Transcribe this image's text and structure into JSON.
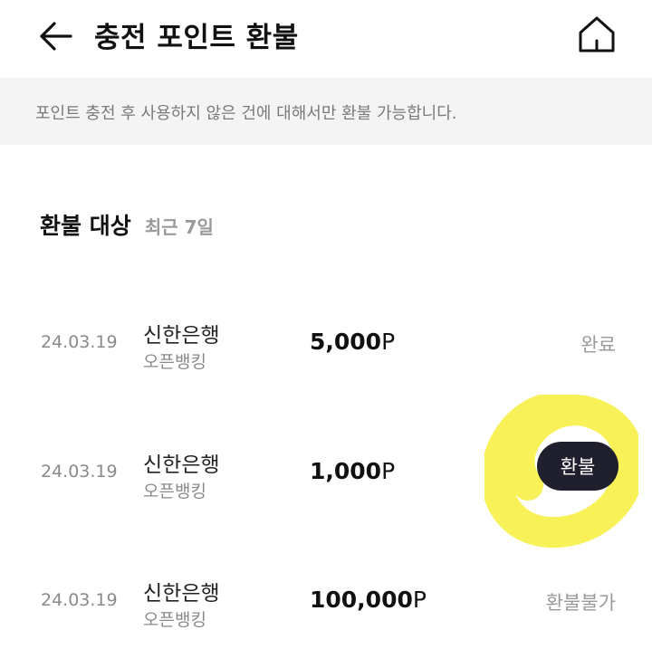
{
  "header": {
    "title": "충전 포인트 환불",
    "back_icon": "arrow-left-icon",
    "home_icon": "home-icon"
  },
  "notice": {
    "text": "포인트 충전 후 사용하지 않은 건에 대해서만 환불 가능합니다."
  },
  "section": {
    "title": "환불 대상",
    "subtitle": "최근 7일"
  },
  "rows": [
    {
      "date": "24.03.19",
      "bank": "신한은행",
      "method": "오픈뱅킹",
      "amount": "5,000",
      "unit": "P",
      "status": "완료"
    },
    {
      "date": "24.03.19",
      "bank": "신한은행",
      "method": "오픈뱅킹",
      "amount": "1,000",
      "unit": "P",
      "action": "환불"
    },
    {
      "date": "24.03.19",
      "bank": "신한은행",
      "method": "오픈뱅킹",
      "amount": "100,000",
      "unit": "P",
      "status": "환불불가"
    }
  ],
  "colors": {
    "highlight": "#f7f04a",
    "button_bg": "#1f1f2e",
    "notice_bg": "#f4f4f4"
  }
}
